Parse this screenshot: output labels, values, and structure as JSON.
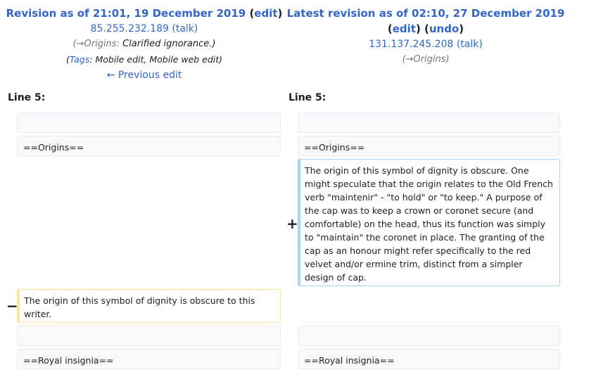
{
  "left_header": {
    "revision_title": "Revision as of 21:01, 19 December 2019",
    "edit_open": "(",
    "edit_link": "edit",
    "edit_close": ")",
    "user": "85.255.232.189",
    "talk_link": "(talk)",
    "comment_prefix": "(",
    "comment_section": "→Origins:",
    "comment_text": "Clarified ignorance.)",
    "tags_open": "(",
    "tags_link": "Tags",
    "tags_text": ": Mobile edit, Mobile web edit)",
    "prev_edit": "← Previous edit"
  },
  "right_header": {
    "revision_title": "Latest revision as of 02:10, 27 December 2019",
    "edit_open": "(",
    "edit_link": "edit",
    "mid": ") (",
    "undo_link": "undo",
    "edit_close": ")",
    "user": "131.137.245.208",
    "talk_link": "(talk)",
    "comment": "(→Origins)"
  },
  "diff": {
    "left_line_label": "Line 5:",
    "right_line_label": "Line 5:",
    "rows": {
      "origins_heading": "==Origins==",
      "added_text": "The origin of this symbol of dignity is obscure. One might speculate that the origin relates to the Old French verb \"maintenir\" - \"to hold\" or \"to keep.\" A purpose of the cap was to keep a crown or coronet secure (and comfortable) on the head, thus its function was simply to \"maintain\" the coronet in place. The granting of the cap as an honour might refer specifically to the red velvet and/or ermine trim, distinct from a simpler design of cap.",
      "removed_text": "The origin of this symbol of dignity is obscure to this writer.",
      "royal_heading": "==Royal insignia=="
    },
    "plus_marker": "+",
    "minus_marker": "−"
  },
  "colors": {
    "link": "#3366cc",
    "added_border": "#a3d3ff",
    "removed_border": "#ffe49c",
    "context_bg": "#f8f9fa"
  }
}
